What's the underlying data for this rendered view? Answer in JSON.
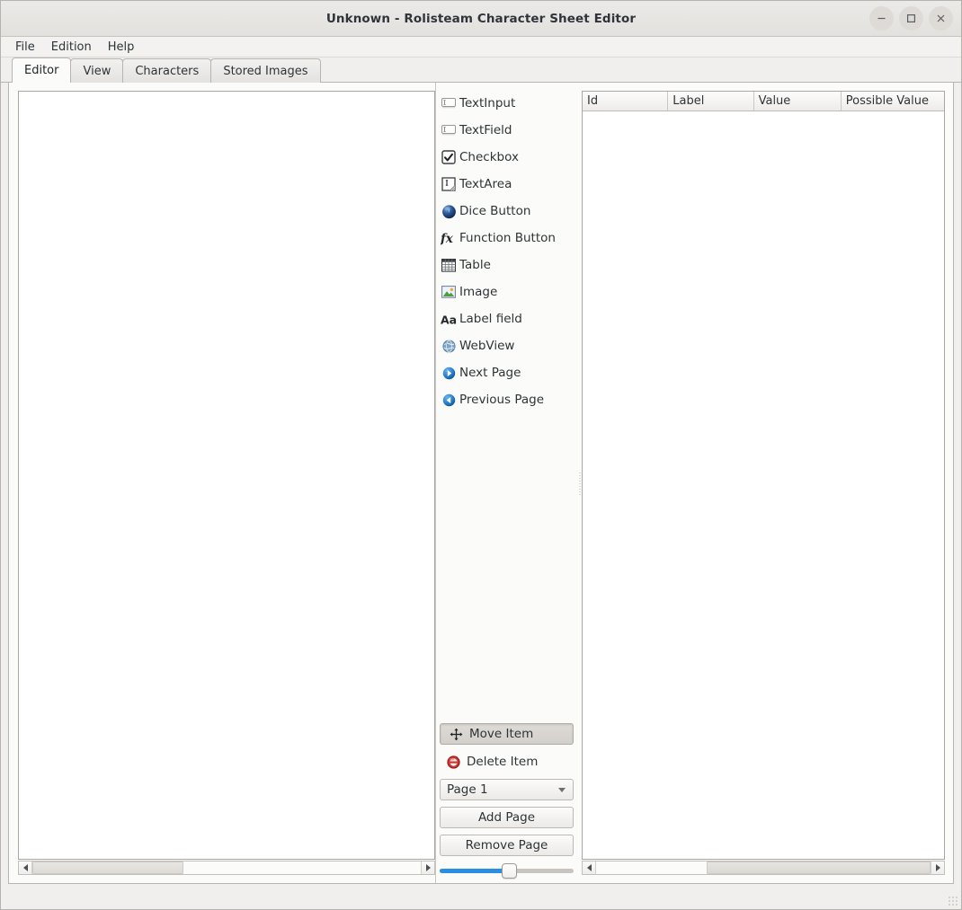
{
  "window": {
    "title": "Unknown - Rolisteam Character Sheet Editor",
    "controls": {
      "minimize": "minimize-button",
      "maximize": "maximize-button",
      "close": "close-button"
    }
  },
  "menubar": {
    "items": [
      {
        "label": "File"
      },
      {
        "label": "Edition"
      },
      {
        "label": "Help"
      }
    ]
  },
  "tabs": {
    "active_index": 0,
    "items": [
      {
        "label": "Editor"
      },
      {
        "label": "View"
      },
      {
        "label": "Characters"
      },
      {
        "label": "Stored Images"
      }
    ]
  },
  "palette": {
    "items": [
      {
        "label": "TextInput",
        "icon": "text-input-icon"
      },
      {
        "label": "TextField",
        "icon": "text-field-icon"
      },
      {
        "label": "Checkbox",
        "icon": "checkbox-icon"
      },
      {
        "label": "TextArea",
        "icon": "text-area-icon"
      },
      {
        "label": "Dice Button",
        "icon": "dice-button-icon"
      },
      {
        "label": "Function Button",
        "icon": "function-button-icon"
      },
      {
        "label": "Table",
        "icon": "table-icon"
      },
      {
        "label": "Image",
        "icon": "image-icon"
      },
      {
        "label": "Label field",
        "icon": "label-field-icon"
      },
      {
        "label": "WebView",
        "icon": "webview-icon"
      },
      {
        "label": "Next Page",
        "icon": "next-page-icon"
      },
      {
        "label": "Previous Page",
        "icon": "previous-page-icon"
      }
    ]
  },
  "actions": {
    "move_item": {
      "label": "Move Item",
      "icon": "move-icon",
      "checked": true
    },
    "delete_item": {
      "label": "Delete Item",
      "icon": "delete-icon"
    },
    "page_select": {
      "value": "Page 1",
      "options": [
        "Page 1"
      ]
    },
    "add_page": {
      "label": "Add Page"
    },
    "remove_page": {
      "label": "Remove Page"
    }
  },
  "zoom_slider": {
    "value": 50,
    "min": 0,
    "max": 100,
    "fill_color": "#2a8fe0"
  },
  "table": {
    "columns": [
      {
        "label": "Id"
      },
      {
        "label": "Label"
      },
      {
        "label": "Value"
      },
      {
        "label": "Possible Value"
      }
    ],
    "rows": []
  },
  "scrollbars": {
    "canvas_h": {
      "left_arrow": "scroll-left-arrow",
      "right_arrow": "scroll-right-arrow"
    },
    "table_h": {
      "left_arrow": "scroll-left-arrow",
      "right_arrow": "scroll-right-arrow"
    }
  },
  "statusbar": {
    "text": ""
  }
}
